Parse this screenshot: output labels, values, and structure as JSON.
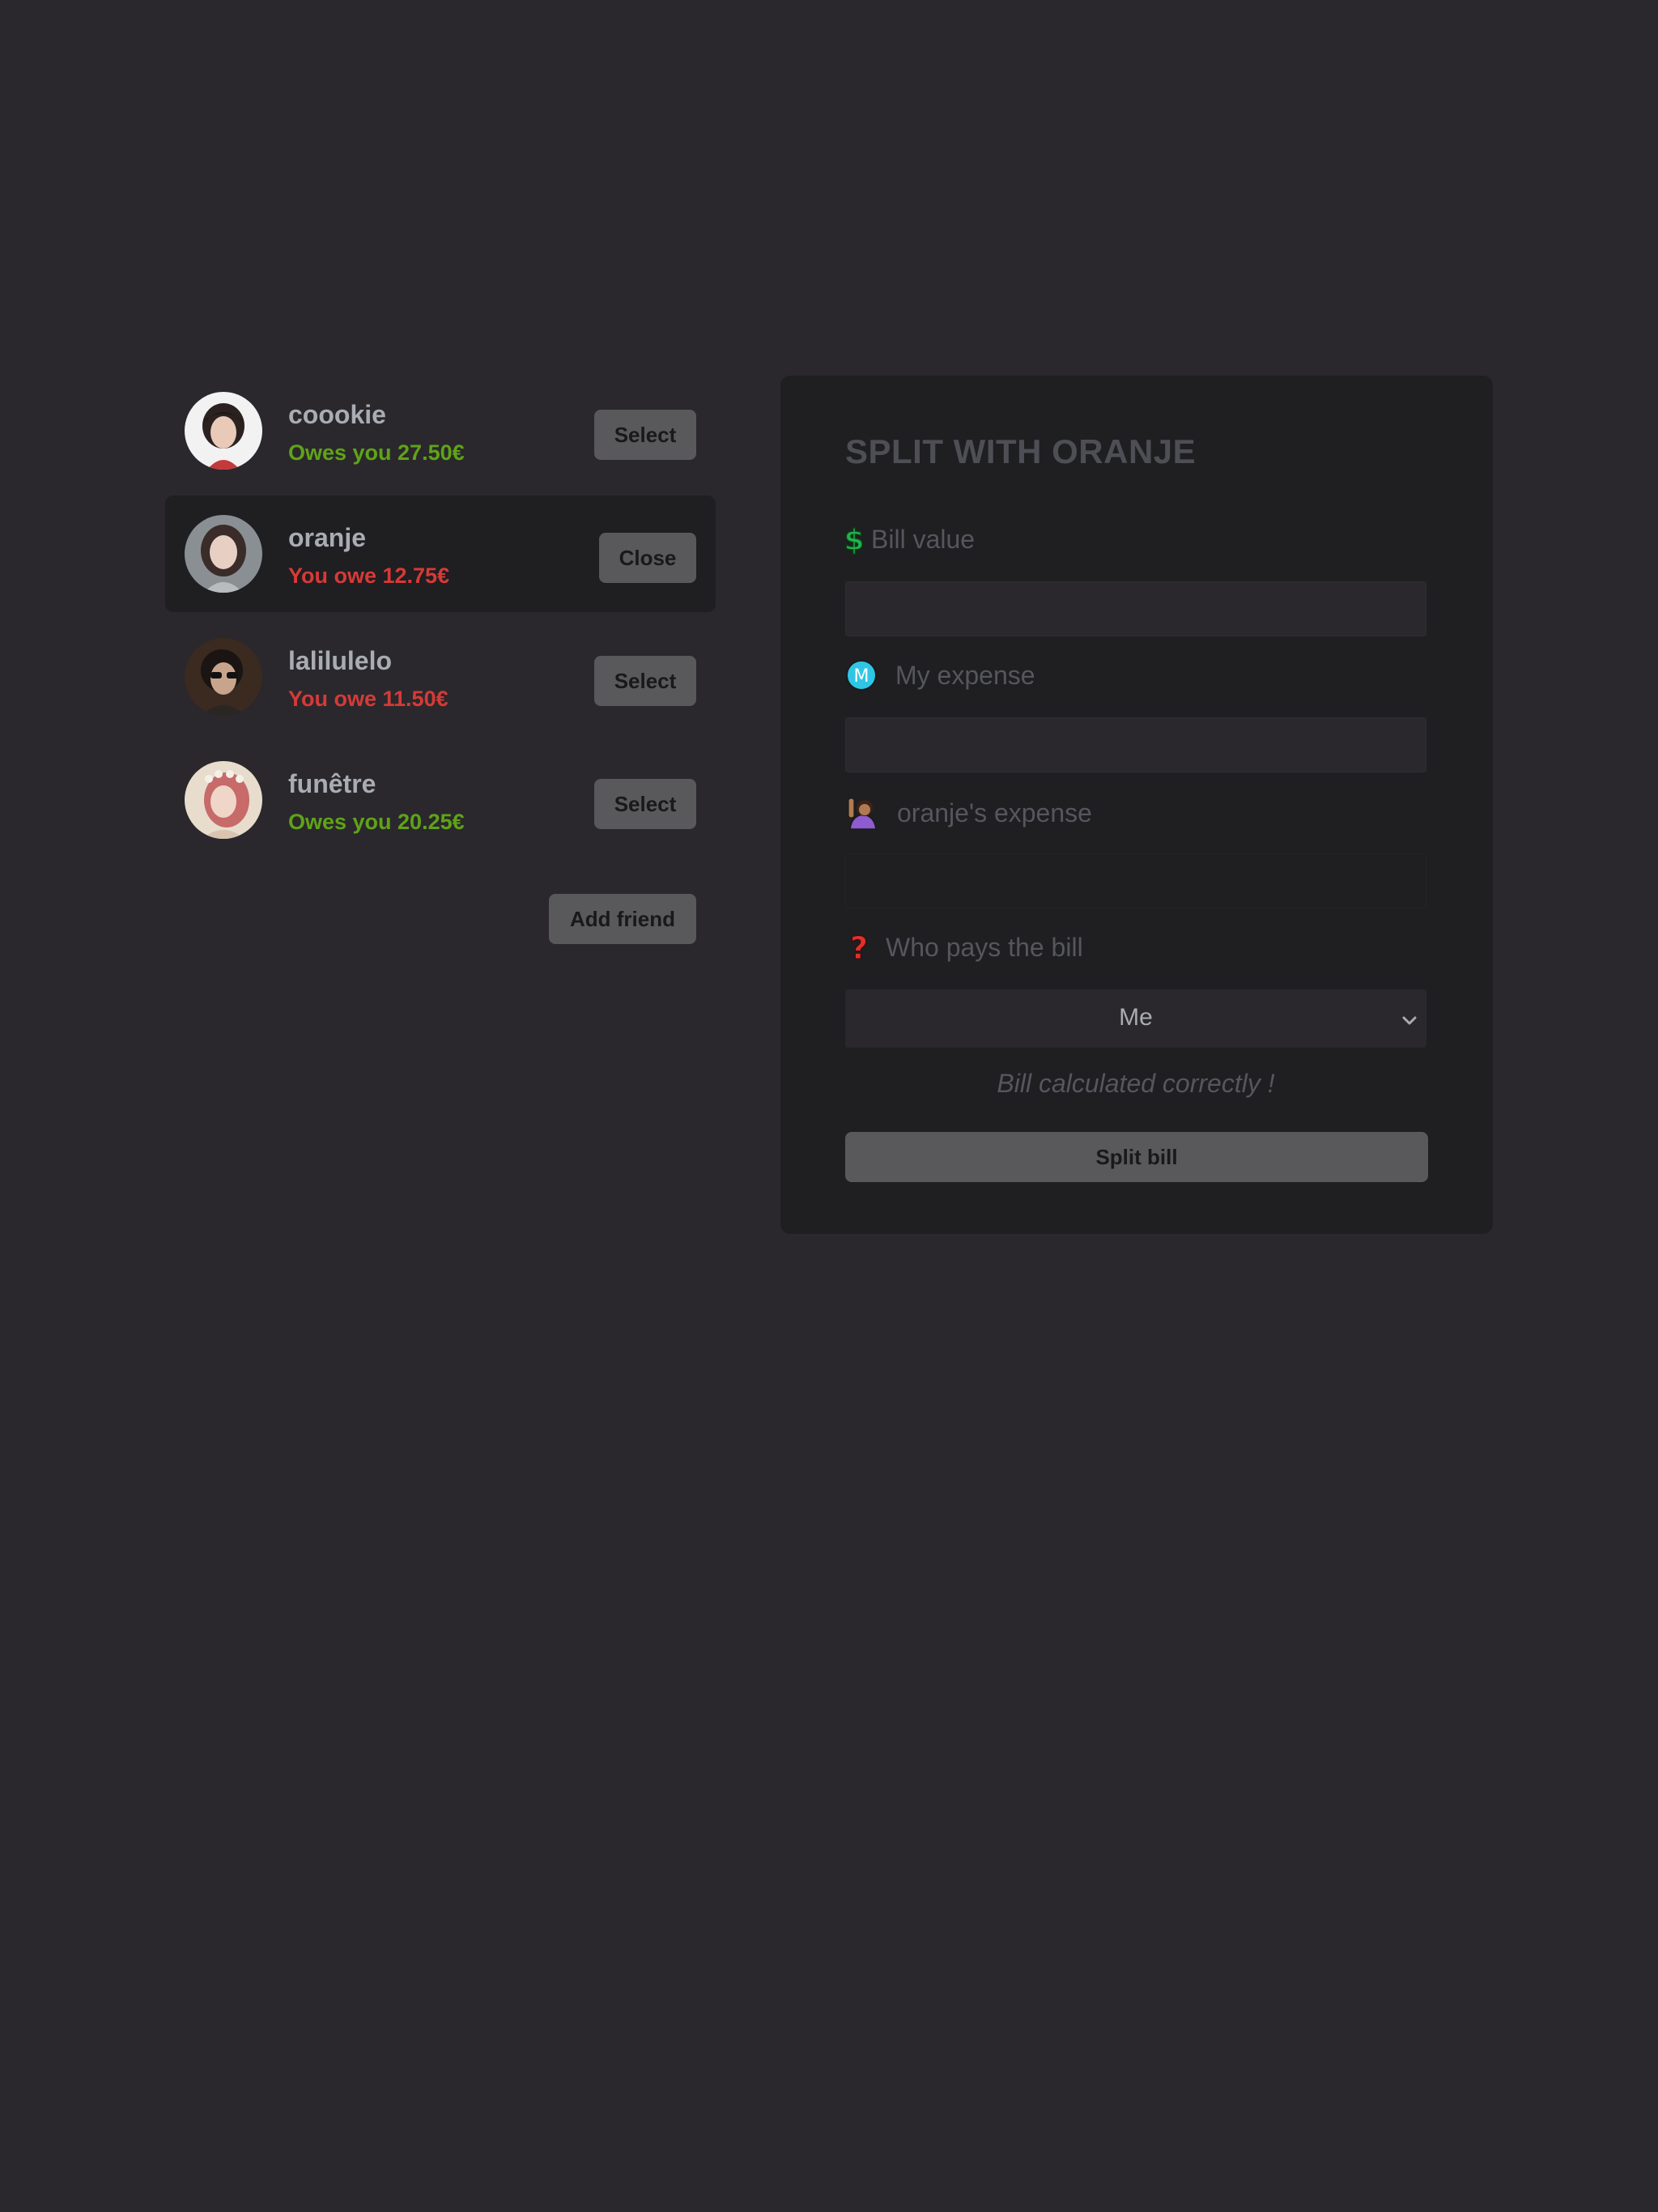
{
  "friends": [
    {
      "name": "coookie",
      "balance": "Owes you 27.50€",
      "status": "owed",
      "button": "Select",
      "selected": false,
      "avatar": "avatar-coookie"
    },
    {
      "name": "oranje",
      "balance": "You owe 12.75€",
      "status": "owe",
      "button": "Close",
      "selected": true,
      "avatar": "avatar-oranje"
    },
    {
      "name": "lalilulelo",
      "balance": "You owe 11.50€",
      "status": "owe",
      "button": "Select",
      "selected": false,
      "avatar": "avatar-lalilulelo"
    },
    {
      "name": "funêtre",
      "balance": "Owes you 20.25€",
      "status": "owed",
      "button": "Select",
      "selected": false,
      "avatar": "avatar-funetre"
    }
  ],
  "add_friend_label": "Add friend",
  "form": {
    "title": "SPLIT WITH ORANJE",
    "bill_label": "Bill value",
    "bill_value": "",
    "bill_icon": "dollar-icon",
    "my_expense_label": "My expense",
    "my_expense_value": "",
    "my_expense_icon": "m-circle-icon",
    "friend_expense_label": "oranje's expense",
    "friend_expense_value": "",
    "friend_expense_icon": "person-raising-hand-icon",
    "payer_label": "Who pays the bill",
    "payer_icon": "question-mark-icon",
    "payer_value": "Me",
    "status_message": "Bill calculated correctly !",
    "submit_label": "Split bill"
  },
  "colors": {
    "background": "#2a282c",
    "panel": "#1f1e21",
    "positive": "#5fa317",
    "negative": "#d63a37",
    "button": "#59585b"
  }
}
